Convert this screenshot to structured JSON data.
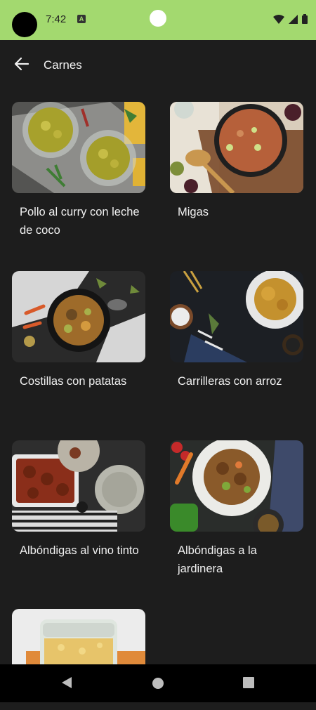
{
  "status_bar": {
    "time": "7:42",
    "notification_glyph": "A",
    "background": "#a3d96f"
  },
  "toolbar": {
    "title": "Carnes",
    "back_icon": "arrow-left-icon"
  },
  "recipes": [
    {
      "title": "Pollo al curry con leche de coco"
    },
    {
      "title": "Migas"
    },
    {
      "title": "Costillas con patatas"
    },
    {
      "title": "Carrilleras con arroz"
    },
    {
      "title": "Albóndigas al vino tinto"
    },
    {
      "title": "Albóndigas a la jardinera"
    },
    {
      "title": ""
    }
  ],
  "nav_bar": {
    "icons": [
      "back-triangle-icon",
      "home-circle-icon",
      "recents-square-icon"
    ]
  }
}
